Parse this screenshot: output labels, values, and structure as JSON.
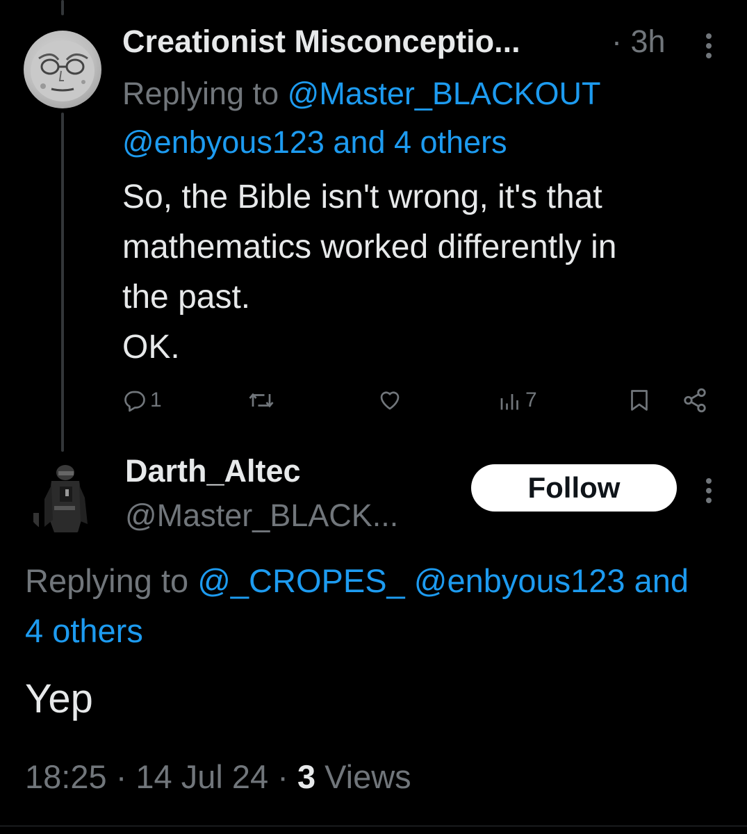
{
  "tweet1": {
    "display_name": "Creationist Misconceptio...",
    "separator": "·",
    "time": "3h",
    "replying_prefix": "Replying to",
    "replying_mention1": "@Master_BLACKOUT",
    "replying_mention2": "@enbyous123 and 4 others",
    "text_line1": "So, the Bible isn't wrong, it's that",
    "text_line2": "mathematics worked differently in",
    "text_line3": "the past.",
    "text_line4": "OK.",
    "reply_count": "1",
    "views_count": "7"
  },
  "tweet2": {
    "display_name": "Darth_Altec",
    "handle": "@Master_BLACK...",
    "follow_label": "Follow",
    "replying_prefix": "Replying to",
    "replying_mentions": "@_CROPES_ @enbyous123 and",
    "replying_others": "4 others",
    "text": "Yep",
    "time": "18:25",
    "date": "14 Jul 24",
    "views_count": "3",
    "views_label": "Views",
    "separator": "·"
  },
  "colors": {
    "background": "#000000",
    "primary_text": "#e7e9ea",
    "secondary_text": "#71767b",
    "link": "#1d9bf0",
    "button_bg": "#ffffff",
    "button_text": "#0f1419"
  },
  "icons": {
    "reply": "reply-icon",
    "retweet": "retweet-icon",
    "like": "heart-icon",
    "views": "views-icon",
    "bookmark": "bookmark-icon",
    "share": "share-icon",
    "more": "more-vertical-icon"
  }
}
